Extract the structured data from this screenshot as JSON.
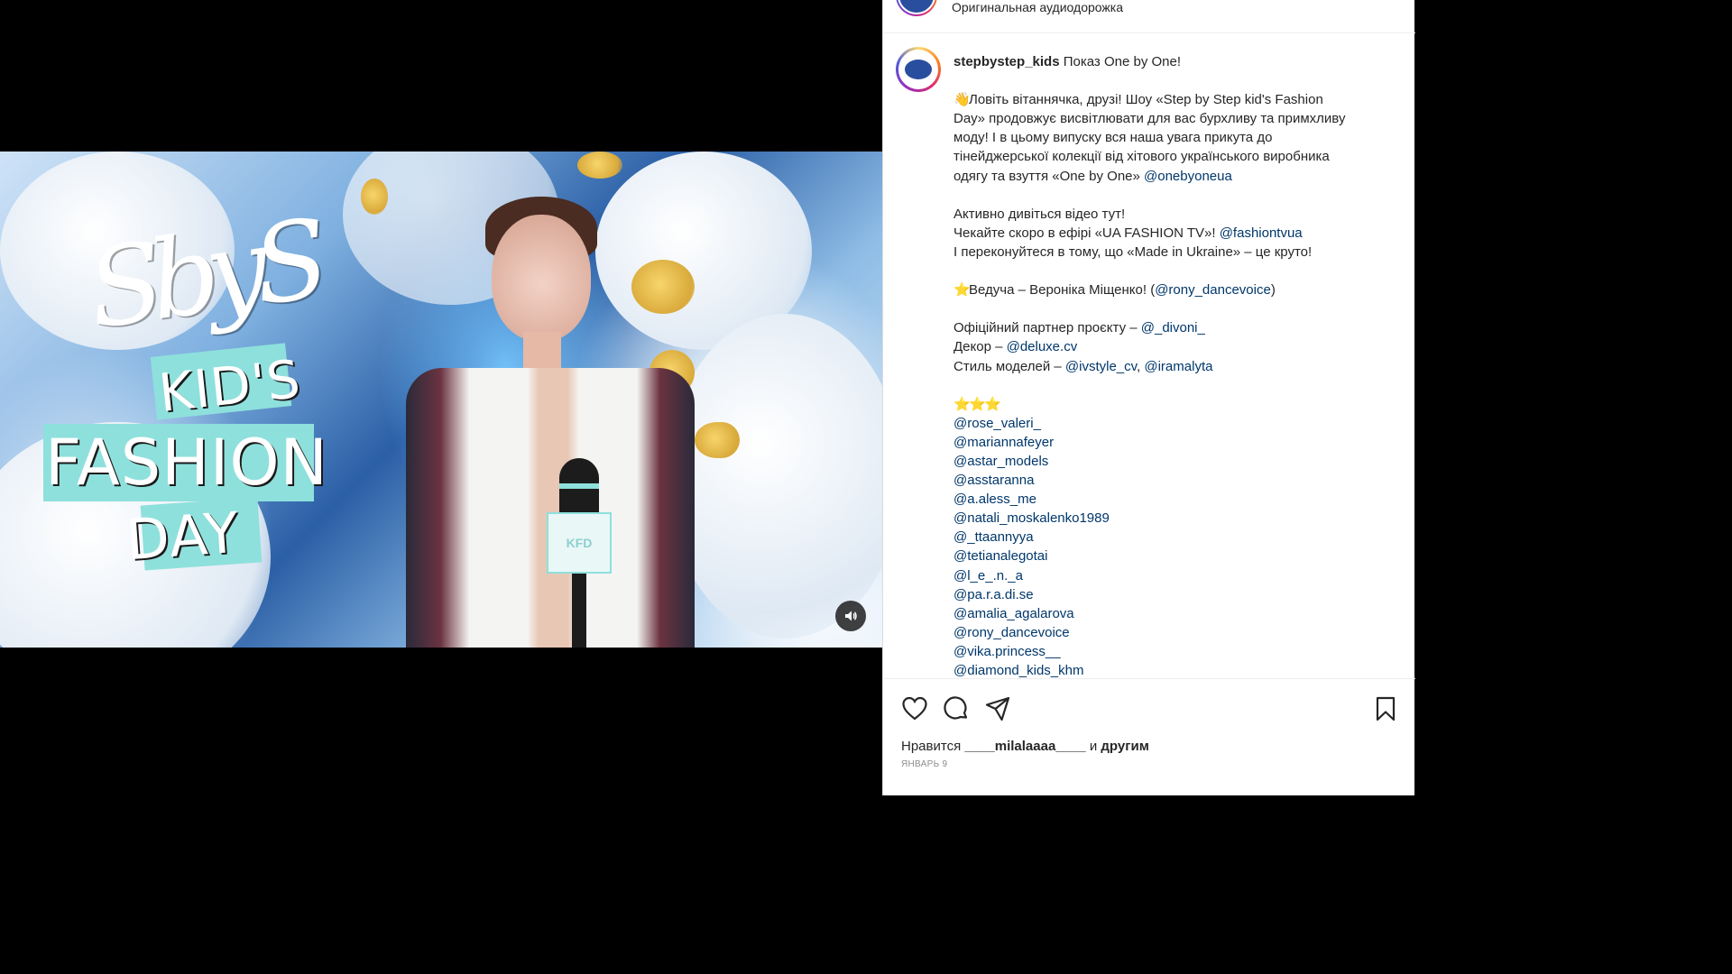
{
  "video": {
    "logo": {
      "script": "SbyS",
      "word1": "KID'S",
      "word2": "FASHION",
      "word3": "DAY"
    },
    "mic_flag_text": "KFD",
    "mute_icon": "speaker-icon",
    "colors": {
      "accent": "#8ee0dc"
    }
  },
  "audio": {
    "label": "Оригинальная аудиодорожка"
  },
  "post": {
    "username": "stepbystep_kids",
    "lines": [
      [
        {
          "t": "text",
          "v": "Показ One by One!"
        }
      ],
      [],
      [
        {
          "t": "emoji",
          "v": "👋"
        },
        {
          "t": "text",
          "v": "Ловіть вітаннячка, друзі! Шоу «Step by Step kid's Fashion"
        }
      ],
      [
        {
          "t": "text",
          "v": "Day» продовжує висвітлювати для вас бурхливу та примхливу"
        }
      ],
      [
        {
          "t": "text",
          "v": "моду! І в цьому випуску вся наша увага прикута до"
        }
      ],
      [
        {
          "t": "text",
          "v": "тінейджерської колекції від хітового українського виробника"
        }
      ],
      [
        {
          "t": "text",
          "v": "одягу та взуття «One by One» "
        },
        {
          "t": "mention",
          "v": "@onebyoneua"
        }
      ],
      [],
      [
        {
          "t": "text",
          "v": "Активно дивіться відео тут!"
        }
      ],
      [
        {
          "t": "text",
          "v": "Чекайте скоро в ефірі «UA FASHION TV»! "
        },
        {
          "t": "mention",
          "v": "@fashiontvua"
        }
      ],
      [
        {
          "t": "text",
          "v": "І переконуйтеся в тому, що «Made in Ukraine» – це круто!"
        }
      ],
      [],
      [
        {
          "t": "emoji",
          "v": "⭐"
        },
        {
          "t": "text",
          "v": "Ведуча – Вероніка Міщенко! ("
        },
        {
          "t": "mention",
          "v": "@rony_dancevoice"
        },
        {
          "t": "text",
          "v": ")"
        }
      ],
      [],
      [
        {
          "t": "text",
          "v": "Офіційний партнер проєкту – "
        },
        {
          "t": "mention",
          "v": "@_divoni_"
        }
      ],
      [
        {
          "t": "text",
          "v": "Декор – "
        },
        {
          "t": "mention",
          "v": "@deluxe.cv"
        }
      ],
      [
        {
          "t": "text",
          "v": "Стиль моделей – "
        },
        {
          "t": "mention",
          "v": "@ivstyle_cv"
        },
        {
          "t": "text",
          "v": ", "
        },
        {
          "t": "mention",
          "v": "@iramalyta"
        }
      ],
      [],
      [
        {
          "t": "emoji",
          "v": "⭐"
        },
        {
          "t": "emoji",
          "v": "⭐"
        },
        {
          "t": "emoji",
          "v": "⭐"
        }
      ],
      [
        {
          "t": "mention",
          "v": "@rose_valeri_"
        }
      ],
      [
        {
          "t": "mention",
          "v": "@mariannafeyer"
        }
      ],
      [
        {
          "t": "mention",
          "v": "@astar_models"
        }
      ],
      [
        {
          "t": "mention",
          "v": "@asstaranna"
        }
      ],
      [
        {
          "t": "mention",
          "v": "@a.aless_me"
        }
      ],
      [
        {
          "t": "mention",
          "v": "@natali_moskalenko1989"
        }
      ],
      [
        {
          "t": "mention",
          "v": "@_ttaannyya"
        }
      ],
      [
        {
          "t": "mention",
          "v": "@tetianalegotai"
        }
      ],
      [
        {
          "t": "mention",
          "v": "@l_e_.n._a"
        }
      ],
      [
        {
          "t": "mention",
          "v": "@pa.r.a.di.se"
        }
      ],
      [
        {
          "t": "mention",
          "v": "@amalia_agalarova"
        }
      ],
      [
        {
          "t": "mention",
          "v": "@rony_dancevoice"
        }
      ],
      [
        {
          "t": "mention",
          "v": "@vika.princess__"
        }
      ],
      [
        {
          "t": "mention",
          "v": "@diamond_kids_khm"
        }
      ]
    ]
  },
  "actions": {
    "like_icon": "heart-icon",
    "comment_icon": "comment-icon",
    "share_icon": "send-icon",
    "save_icon": "bookmark-icon"
  },
  "likes": {
    "prefix": "Нравится",
    "user": "____milalaaaa____",
    "middle": "и",
    "suffix": "другим"
  },
  "date": "ЯНВАРЬ 9"
}
